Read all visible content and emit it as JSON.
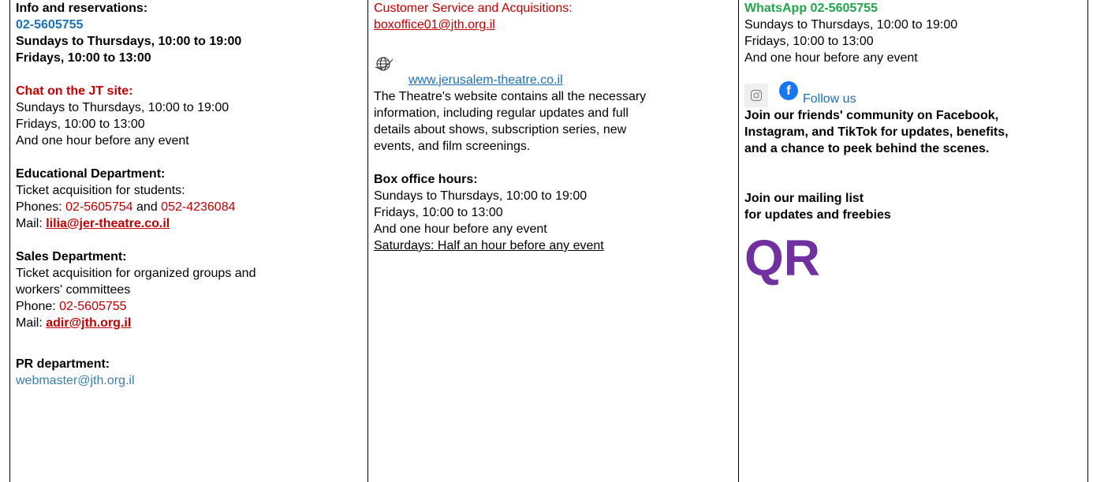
{
  "col1": {
    "info_title": "Info and reservations:",
    "info_phone": "02-5605755",
    "info_hours_1": "Sundays to Thursdays, 10:00 to 19:00",
    "info_hours_2": "Fridays, 10:00 to 13:00",
    "chat_title": "Chat on the JT site:",
    "chat_hours_1": "Sundays to Thursdays, 10:00 to 19:00",
    "chat_hours_2": "Fridays, 10:00 to 13:00",
    "chat_hours_3": "And one hour before any event",
    "edu_title": "Educational Department:",
    "edu_desc": "Ticket acquisition for students:",
    "edu_phones_label": "Phones: ",
    "edu_phone_1": "02-5605754",
    "edu_and": " and ",
    "edu_phone_2": "052-4236084",
    "edu_mail_label": "Mail:  ",
    "edu_mail": "lilia@jer-theatre.co.il",
    "sales_title": "Sales Department:",
    "sales_desc_1": "Ticket acquisition for organized groups and",
    "sales_desc_2": "workers' committees",
    "sales_phone_label": "Phone: ",
    "sales_phone": "02-5605755",
    "sales_mail_label": "Mail:  ",
    "sales_mail": "adir@jth.org.il",
    "pr_title": "PR department:",
    "pr_mail": "webmaster@jth.org.il"
  },
  "col2": {
    "cs_title": "Customer Service and Acquisitions:",
    "cs_mail": "boxoffice01@jth.org.il",
    "website": "www.jerusalem-theatre.co.il",
    "web_desc_1": "The Theatre's website contains all the necessary",
    "web_desc_2": "information, including regular updates and full",
    "web_desc_3": "details about shows, subscription series, new",
    "web_desc_4": "events, and film screenings.",
    "box_title": "Box office hours:",
    "box_hours_1": "Sundays to Thursdays, 10:00 to 19:00",
    "box_hours_2": "Fridays, 10:00 to 13:00",
    "box_hours_3": "And one hour before any event",
    "box_hours_4": "Saturdays: Half an hour before any event"
  },
  "col3": {
    "whatsapp_title": "WhatsApp 02-5605755",
    "wa_hours_1": "Sundays to Thursdays, 10:00 to 19:00",
    "wa_hours_2": "Fridays, 10:00 to 13:00",
    "wa_hours_3": "And one hour before any event",
    "follow_us": "Follow us",
    "community_1": "Join our friends' community on Facebook,",
    "community_2": "Instagram, and TikTok for updates, benefits,",
    "community_3": "and a chance to peek behind the scenes.",
    "mailing_1": "Join our mailing list",
    "mailing_2": "for updates and freebies",
    "qr": "QR",
    "fb_letter": "f"
  },
  "colors": {
    "blue": "#1a72b8",
    "red": "#c00000",
    "green": "#22a64b",
    "purple": "#7030a0",
    "facebook": "#1877f2"
  },
  "icons": {
    "globe": "globe-icon",
    "instagram": "instagram-icon",
    "facebook": "facebook-icon"
  }
}
